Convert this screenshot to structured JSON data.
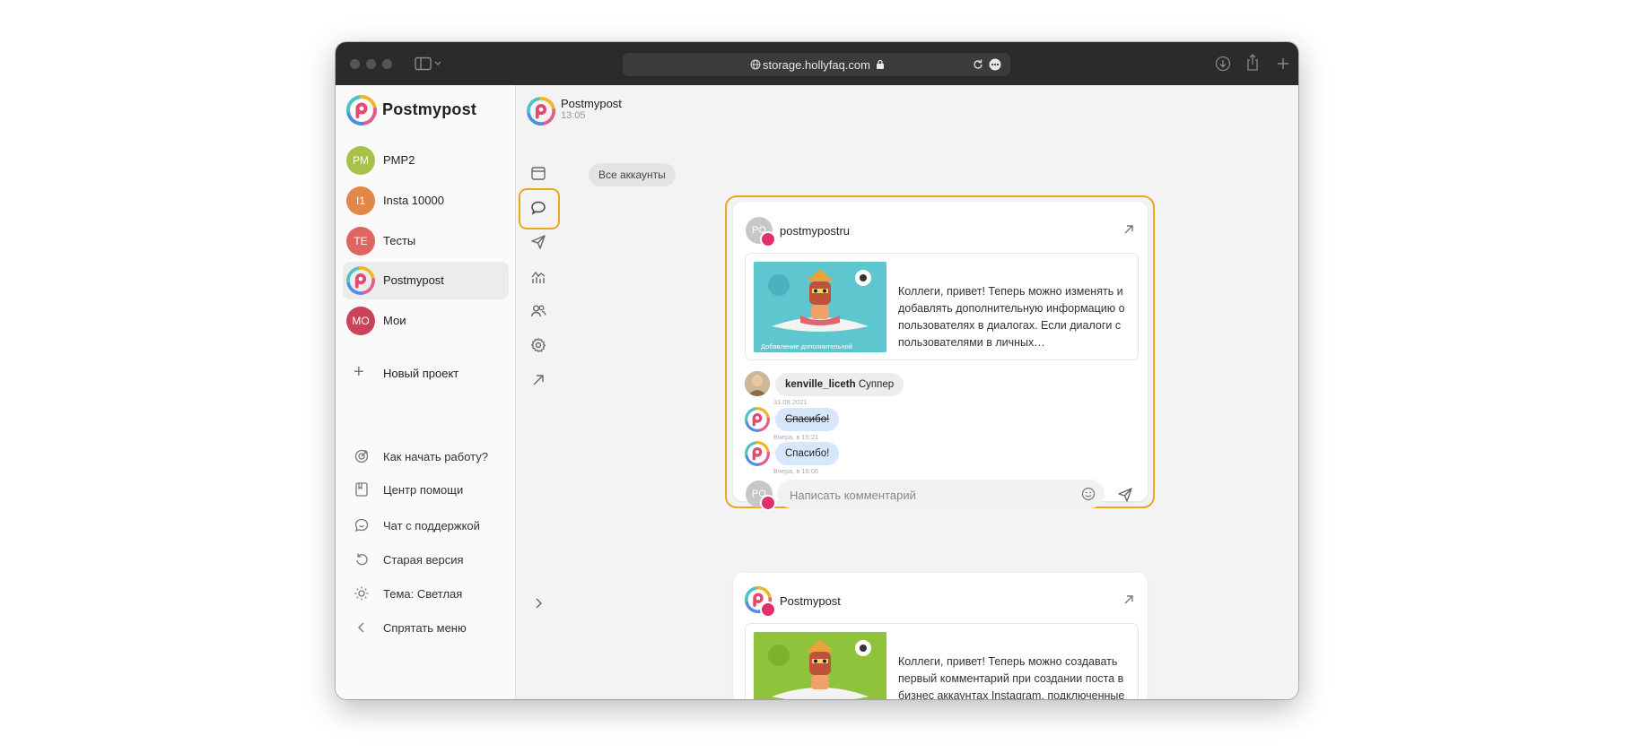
{
  "browser": {
    "url": "storage.hollyfaq.com"
  },
  "sidebar": {
    "brand": "Postmypost",
    "projects": [
      {
        "initials": "PM",
        "label": "PMP2",
        "color": "#a8c249"
      },
      {
        "initials": "I1",
        "label": "Insta 10000",
        "color": "#e2874a"
      },
      {
        "initials": "TE",
        "label": "Тесты",
        "color": "#e06560"
      },
      {
        "initials": "",
        "label": "Postmypost",
        "color": "#ffffff"
      },
      {
        "initials": "MO",
        "label": "Мои",
        "color": "#c7445a"
      }
    ],
    "new_project": "Новый проект",
    "menu": [
      {
        "icon": "target-icon",
        "label": "Как начать работу?"
      },
      {
        "icon": "book-icon",
        "label": "Центр помощи"
      },
      {
        "icon": "chat-smile-icon",
        "label": "Чат с поддержкой"
      },
      {
        "icon": "undo-icon",
        "label": "Старая версия"
      },
      {
        "icon": "sun-icon",
        "label": "Тема: Светлая"
      },
      {
        "icon": "chevron-left-icon",
        "label": "Спрятать меню"
      }
    ]
  },
  "channel": {
    "name": "Postmypost",
    "time": "13:05"
  },
  "rail": {
    "icons": [
      "calendar-icon",
      "comment-icon",
      "send-icon",
      "analytics-icon",
      "users-icon",
      "settings-icon",
      "external-link-icon"
    ],
    "active": "comment-icon"
  },
  "filter": {
    "label": "Все аккаунты"
  },
  "cards": [
    {
      "account_initials": "PO",
      "account": "postmypostru",
      "post_text": "Коллеги, привет! Теперь можно изменять и добавлять дополнительную информацию о пользователях в диалогах. Если диалоги с пользователями в личных…",
      "thumb_caption": "Добавление дополнительной",
      "comments": [
        {
          "author": "kenville_liceth",
          "text": "Суппер",
          "date": "31.08.2021",
          "style": "grey"
        },
        {
          "author": "",
          "text": "Спасибо!",
          "date": "Вчера, в 15:21",
          "style": "blue",
          "strike": true
        },
        {
          "author": "",
          "text": "Спасибо!",
          "date": "Вчера, в 16:06",
          "style": "blue",
          "strike": false
        }
      ],
      "reply_initials": "PO",
      "reply_placeholder": "Написать комментарий"
    },
    {
      "account": "Postmypost",
      "post_text": "Коллеги, привет! Теперь можно создавать первый комментарий при создании поста в бизнес аккаунтах Instagram, подключенные через Facebook. Ранее…"
    }
  ],
  "colors": {
    "accent": "#e8a824",
    "instagram": "#e1306c",
    "bubble_blue": "#d6e6fb",
    "thumb1_bg": "#5ec6cf",
    "thumb2_bg": "#8fc33c"
  }
}
